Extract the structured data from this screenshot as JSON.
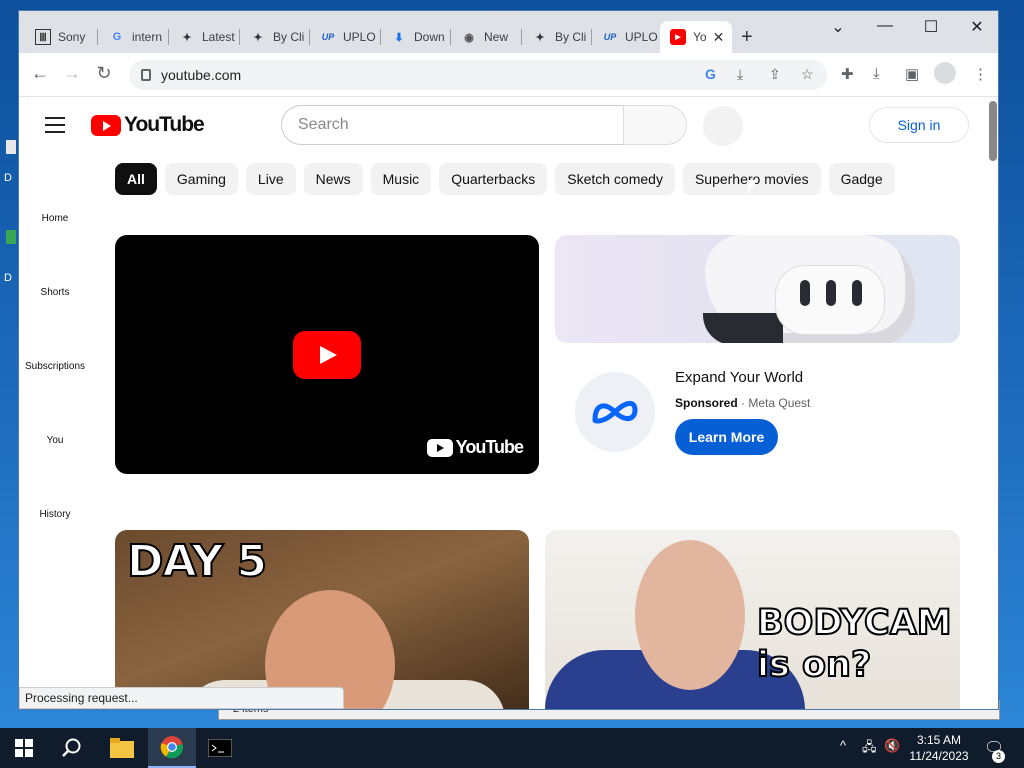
{
  "browser": {
    "tabs": [
      {
        "label": "Sony",
        "icon": "Ⅲ"
      },
      {
        "label": "intern",
        "icon": "G"
      },
      {
        "label": "Latest",
        "icon": "✦"
      },
      {
        "label": "By Cli",
        "icon": "✦"
      },
      {
        "label": "UPLO",
        "icon": "UP"
      },
      {
        "label": "Down",
        "icon": "⬇"
      },
      {
        "label": "New",
        "icon": "◉"
      },
      {
        "label": "By Cli",
        "icon": "✦"
      },
      {
        "label": "UPLO",
        "icon": "UP"
      },
      {
        "label": "Yo",
        "icon": "▶"
      }
    ],
    "url": "youtube.com",
    "status": "Processing request..."
  },
  "youtube": {
    "logo": "YouTube",
    "search_placeholder": "Search",
    "signin": "Sign in",
    "chips": [
      "All",
      "Gaming",
      "Live",
      "News",
      "Music",
      "Quarterbacks",
      "Sketch comedy",
      "Superhero movies",
      "Gadge"
    ],
    "sidebar": [
      "Home",
      "Shorts",
      "Subscriptions",
      "You",
      "History"
    ],
    "player_watermark": "YouTube",
    "ad": {
      "title": "Expand Your World",
      "sponsored": "Sponsored",
      "advertiser": "Meta Quest",
      "cta": "Learn More"
    },
    "thumb1_text": "DAY 5",
    "thumb2_text_line1": "BODYCAM",
    "thumb2_text_line2": "is on?"
  },
  "desktop": {
    "behind_window_text": "2 items"
  },
  "taskbar": {
    "time": "3:15 AM",
    "date": "11/24/2023",
    "notifications": "3"
  },
  "colors": {
    "youtube_red": "#ff0000",
    "link_blue": "#065fd4"
  }
}
